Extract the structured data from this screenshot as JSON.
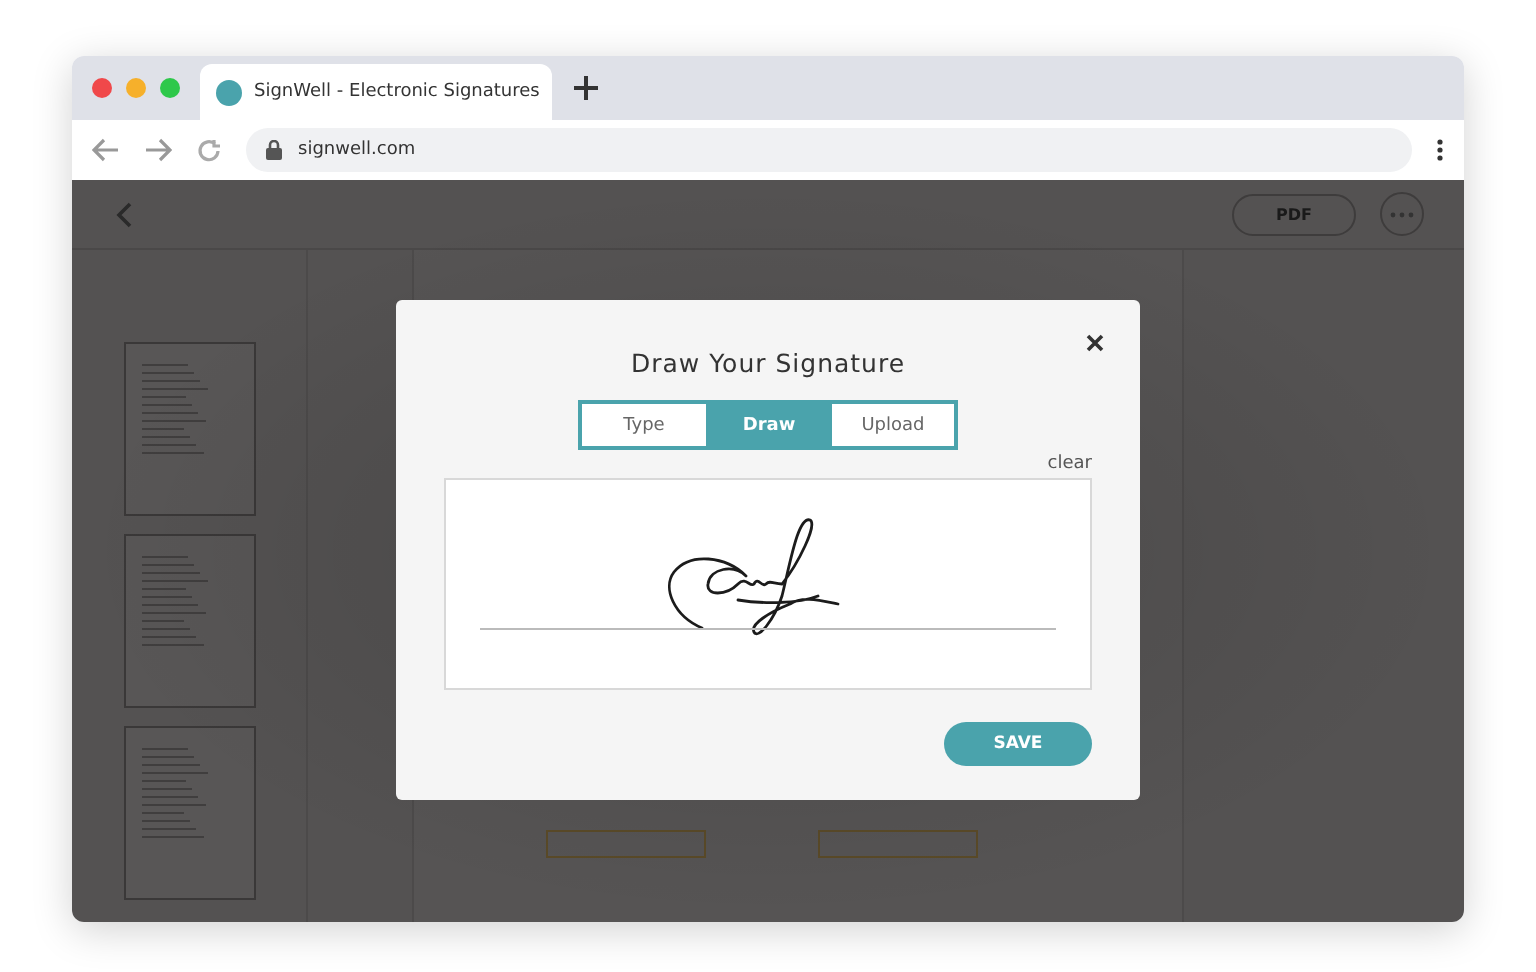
{
  "browser": {
    "tab_title": "SignWell - Electronic Signatures",
    "url": "signwell.com"
  },
  "toolbar": {
    "pdf_button": "PDF"
  },
  "modal": {
    "title": "Draw Your Signature",
    "tabs": [
      {
        "label": "Type",
        "selected": false
      },
      {
        "label": "Draw",
        "selected": true
      },
      {
        "label": "Upload",
        "selected": false
      }
    ],
    "clear_link": "clear",
    "save_button": "SAVE"
  }
}
